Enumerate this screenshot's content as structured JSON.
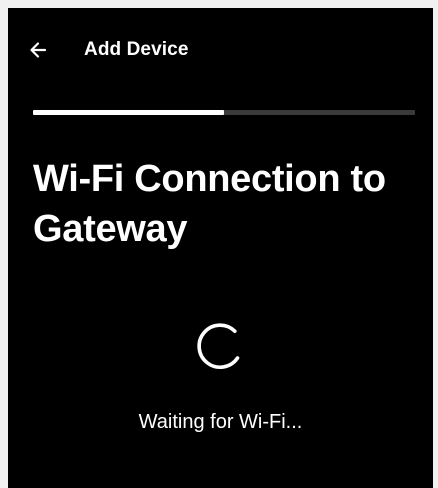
{
  "header": {
    "back_icon": "arrow-left-icon",
    "title": "Add Device"
  },
  "progress": {
    "fraction": 0.5
  },
  "main": {
    "heading": "Wi-Fi Connection to Gateway",
    "spinner_icon": "loading-spinner-icon",
    "status": "Waiting for Wi-Fi..."
  },
  "colors": {
    "background": "#000000",
    "text": "#ffffff",
    "progress_fill": "#ffffff",
    "progress_track": "#3a3a3a"
  }
}
